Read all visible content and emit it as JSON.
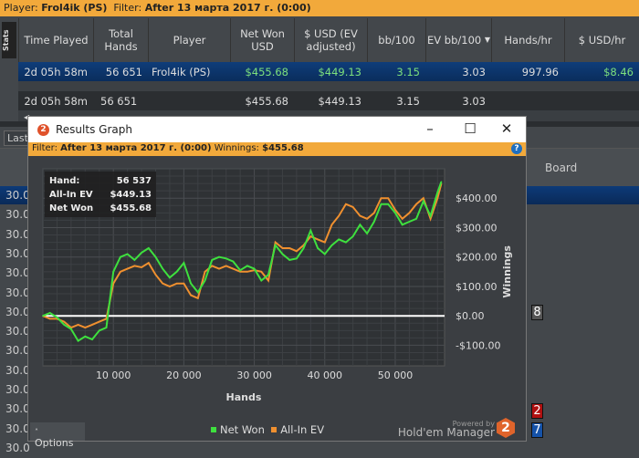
{
  "topbar": {
    "player_label": "Player:",
    "player": "Frol4ik (PS)",
    "filter_label": "Filter:",
    "filter": "After 13 марта 2017 г. (0:00)"
  },
  "stats_tab": "Stats",
  "columns": [
    "Time Played",
    "Total Hands",
    "Player",
    "Net Won USD",
    "$ USD (EV adjusted)",
    "bb/100",
    "EV bb/100",
    "Hands/hr",
    "$ USD/hr"
  ],
  "rows": [
    {
      "time": "2d 05h 58m",
      "hands": "56 651",
      "player": "Frol4ik (PS)",
      "net": "$455.68",
      "ev": "$449.13",
      "bb": "3.15",
      "evbb": "3.03",
      "hph": "997.96",
      "usdhr": "$8.46"
    },
    {
      "time": "2d 05h 58m",
      "hands": "56 651",
      "player": "",
      "net": "$455.68",
      "ev": "$449.13",
      "bb": "3.15",
      "evbb": "3.03",
      "hph": "",
      "usdhr": ""
    }
  ],
  "last_label": "Last",
  "board_label": "Board",
  "left_values": [
    "30.0",
    "30.0",
    "30.0",
    "30.0",
    "30.0",
    "30.0",
    "30.0",
    "30.0",
    "30.0",
    "30.0",
    "30.0",
    "30.0",
    "30.0",
    "30.0"
  ],
  "cards": [
    "8",
    "2",
    "7"
  ],
  "window": {
    "title": "Results Graph",
    "filter_label": "Filter:",
    "filter": "After 13 марта 2017 г. (0:00)",
    "winnings_label": "Winnings:",
    "winnings": "$455.68",
    "options": "Options",
    "powered": "Powered by",
    "brand": "Hold'em Manager",
    "logo": "2"
  },
  "tooltip": {
    "hand_label": "Hand:",
    "hand": "56 537",
    "ev_label": "All-In EV",
    "ev": "$449.13",
    "net_label": "Net Won",
    "net": "$455.68"
  },
  "colors": {
    "net": "#3ee03e",
    "ev": "#f0902f",
    "accent": "#f2a93b"
  },
  "chart_data": {
    "type": "line",
    "xlabel": "Hands",
    "ylabel": "Winnings",
    "xlim": [
      0,
      57000
    ],
    "ylim": [
      -170,
      500
    ],
    "xticks": [
      10000,
      20000,
      30000,
      40000,
      50000
    ],
    "xtick_labels": [
      "10 000",
      "20 000",
      "30 000",
      "40 000",
      "50 000"
    ],
    "yticks": [
      -100,
      0,
      100,
      200,
      300,
      400
    ],
    "ytick_labels": [
      "-$100.00",
      "$0.00",
      "$100.00",
      "$200.00",
      "$300.00",
      "$400.00"
    ],
    "x": [
      0,
      1000,
      2000,
      3000,
      4000,
      5000,
      6000,
      7000,
      8000,
      9000,
      10000,
      11000,
      12000,
      13000,
      14000,
      15000,
      16000,
      17000,
      18000,
      19000,
      20000,
      21000,
      22000,
      23000,
      24000,
      25000,
      26000,
      27000,
      28000,
      29000,
      30000,
      31000,
      32000,
      33000,
      34000,
      35000,
      36000,
      37000,
      38000,
      39000,
      40000,
      41000,
      42000,
      43000,
      44000,
      45000,
      46000,
      47000,
      48000,
      49000,
      50000,
      51000,
      52000,
      53000,
      54000,
      55000,
      56000,
      56537
    ],
    "series": [
      {
        "name": "Net Won",
        "values": [
          0,
          10,
          -5,
          -30,
          -45,
          -85,
          -70,
          -80,
          -50,
          -40,
          150,
          200,
          210,
          190,
          215,
          230,
          200,
          160,
          130,
          150,
          180,
          110,
          80,
          120,
          190,
          200,
          195,
          185,
          155,
          170,
          160,
          120,
          140,
          240,
          210,
          190,
          195,
          230,
          290,
          230,
          210,
          240,
          260,
          250,
          270,
          310,
          280,
          320,
          380,
          380,
          350,
          310,
          320,
          330,
          390,
          340,
          420,
          455.68
        ]
      },
      {
        "name": "All-In EV",
        "values": [
          0,
          -10,
          -10,
          -20,
          -40,
          -30,
          -40,
          -30,
          -20,
          -10,
          110,
          150,
          160,
          170,
          165,
          180,
          140,
          110,
          100,
          110,
          110,
          70,
          60,
          150,
          170,
          160,
          170,
          160,
          150,
          150,
          155,
          150,
          120,
          250,
          230,
          230,
          220,
          240,
          270,
          260,
          250,
          310,
          340,
          380,
          370,
          340,
          330,
          350,
          400,
          400,
          360,
          330,
          350,
          380,
          400,
          330,
          400,
          449.13
        ]
      }
    ],
    "legend": "bottom"
  }
}
